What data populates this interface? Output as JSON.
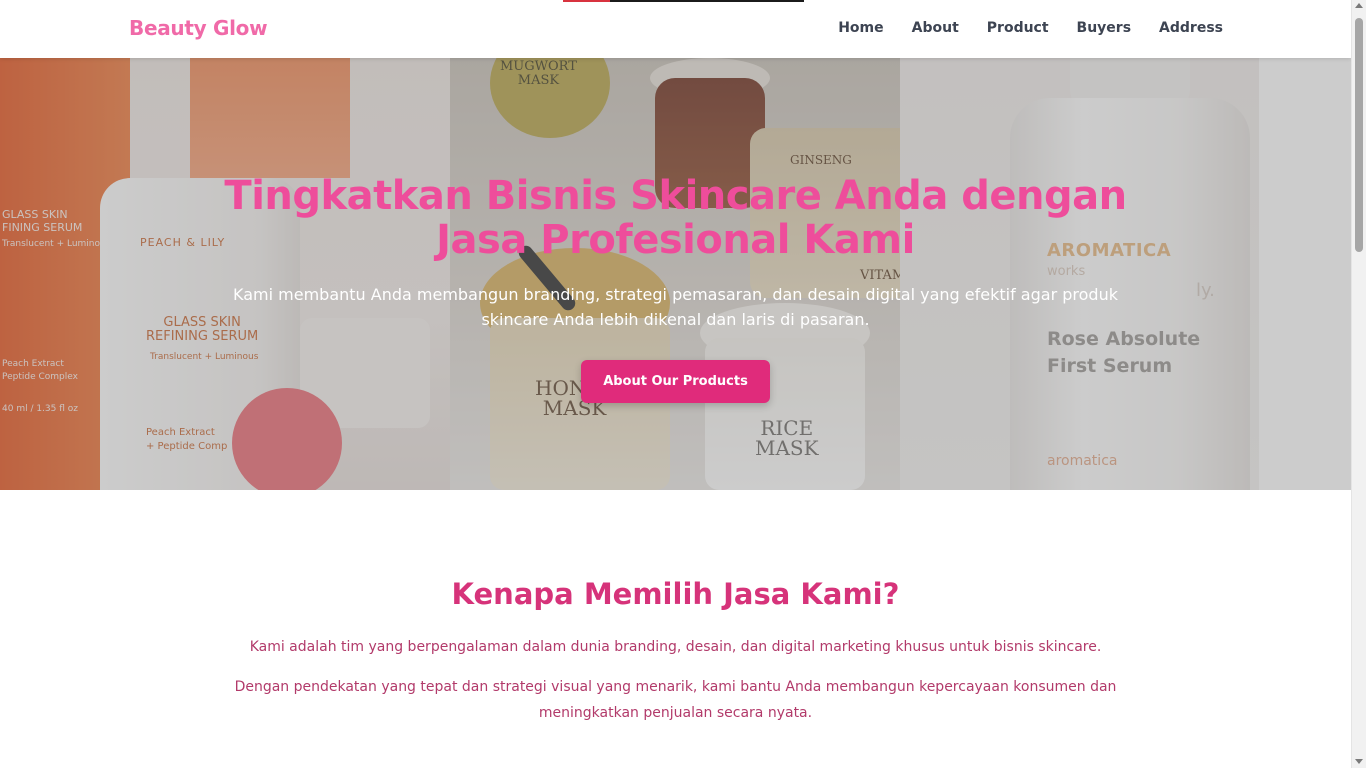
{
  "navbar": {
    "brand": "Beauty Glow",
    "links": [
      "Home",
      "About",
      "Product",
      "Buyers",
      "Address"
    ]
  },
  "hero": {
    "title_line1": "Tingkatkan Bisnis Skincare Anda dengan",
    "title_line2": "Jasa Profesional Kami",
    "subtitle": "Kami membantu Anda membangun branding, strategi pemasaran, dan desain digital yang efektif agar produk skincare Anda lebih dikenal dan laris di pasaran.",
    "cta_label": "About Our Products",
    "image_texts": {
      "left_box": "GLASS SKIN\nFINING SERUM",
      "left_box_sub": "Translucent + Luminous",
      "left_brand": "PEACH & LILY",
      "left_label": "GLASS SKIN\nREFINING SERUM",
      "left_label_sub": "Translucent + Luminous",
      "left_label_ext": "Peach Extract\n+ Peptide Comp",
      "left_box_bottom": "Peach Extract\nPeptide Complex",
      "left_box_vol": "40 ml / 1.35 fl oz",
      "mid_top": "MUGWORT\nMASK",
      "mid_ginseng": "GINSENG",
      "mid_honey": "HONEY\nMASK",
      "mid_rice": "RICE\nMASK",
      "mid_vita": "VITAM",
      "right_brand": "AROMATICA",
      "right_works": "works",
      "right_ly": "ly.",
      "right_product": "Rose Absolute\nFirst Serum",
      "right_bottom": "aromatica"
    }
  },
  "why": {
    "title": "Kenapa Memilih Jasa Kami?",
    "paragraph1": "Kami adalah tim yang berpengalaman dalam dunia branding, desain, dan digital marketing khusus untuk bisnis skincare.",
    "paragraph2": "Dengan pendekatan yang tepat dan strategi visual yang menarik, kami bantu Anda membangun kepercayaan konsumen dan meningkatkan penjualan secara nyata."
  },
  "colors": {
    "brand_pink": "#f06aa8",
    "hero_title_pink": "#ee4d9b",
    "button_pink": "#e02b7b",
    "section_title": "#d6337a",
    "section_text": "#b23a6a",
    "nav_text": "#3d4452"
  }
}
